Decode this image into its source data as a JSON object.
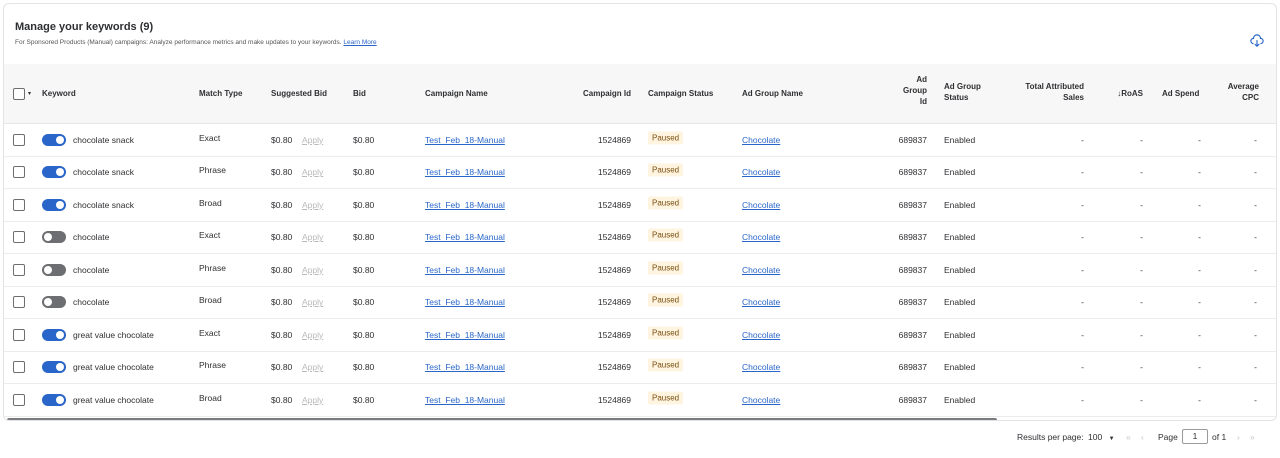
{
  "header": {
    "title": "Manage your keywords (9)",
    "subtitle": "For Sponsored Products (Manual) campaigns: Analyze performance metrics and make updates to your keywords.",
    "learn_more": "Learn More"
  },
  "columns": {
    "keyword": "Keyword",
    "match_type": "Match Type",
    "suggested_bid": "Suggested Bid",
    "bid": "Bid",
    "campaign_name": "Campaign Name",
    "campaign_id": "Campaign Id",
    "campaign_status": "Campaign Status",
    "ad_group_name": "Ad Group Name",
    "ad_group_id_1": "Ad",
    "ad_group_id_2": "Group",
    "ad_group_id_3": "Id",
    "ad_group_status_1": "Ad Group",
    "ad_group_status_2": "Status",
    "total_sales_1": "Total Attributed",
    "total_sales_2": "Sales",
    "roas": "↓RoAS",
    "ad_spend": "Ad Spend",
    "avg_cpc_1": "Average",
    "avg_cpc_2": "CPC"
  },
  "apply_label": "Apply",
  "rows": [
    {
      "enabled": true,
      "keyword": "chocolate snack",
      "match": "Exact",
      "suggested": "$0.80",
      "bid": "$0.80",
      "campaign": "Test_Feb_18-Manual",
      "campaign_id": "1524869",
      "status": "Paused",
      "ad_group": "Chocolate",
      "ad_group_id": "689837",
      "ad_group_status": "Enabled",
      "sales": "-",
      "roas": "-",
      "spend": "-",
      "cpc": "-"
    },
    {
      "enabled": true,
      "keyword": "chocolate snack",
      "match": "Phrase",
      "suggested": "$0.80",
      "bid": "$0.80",
      "campaign": "Test_Feb_18-Manual",
      "campaign_id": "1524869",
      "status": "Paused",
      "ad_group": "Chocolate",
      "ad_group_id": "689837",
      "ad_group_status": "Enabled",
      "sales": "-",
      "roas": "-",
      "spend": "-",
      "cpc": "-"
    },
    {
      "enabled": true,
      "keyword": "chocolate snack",
      "match": "Broad",
      "suggested": "$0.80",
      "bid": "$0.80",
      "campaign": "Test_Feb_18-Manual",
      "campaign_id": "1524869",
      "status": "Paused",
      "ad_group": "Chocolate",
      "ad_group_id": "689837",
      "ad_group_status": "Enabled",
      "sales": "-",
      "roas": "-",
      "spend": "-",
      "cpc": "-"
    },
    {
      "enabled": false,
      "keyword": "chocolate",
      "match": "Exact",
      "suggested": "$0.80",
      "bid": "$0.80",
      "campaign": "Test_Feb_18-Manual",
      "campaign_id": "1524869",
      "status": "Paused",
      "ad_group": "Chocolate",
      "ad_group_id": "689837",
      "ad_group_status": "Enabled",
      "sales": "-",
      "roas": "-",
      "spend": "-",
      "cpc": "-"
    },
    {
      "enabled": false,
      "keyword": "chocolate",
      "match": "Phrase",
      "suggested": "$0.80",
      "bid": "$0.80",
      "campaign": "Test_Feb_18-Manual",
      "campaign_id": "1524869",
      "status": "Paused",
      "ad_group": "Chocolate",
      "ad_group_id": "689837",
      "ad_group_status": "Enabled",
      "sales": "-",
      "roas": "-",
      "spend": "-",
      "cpc": "-"
    },
    {
      "enabled": false,
      "keyword": "chocolate",
      "match": "Broad",
      "suggested": "$0.80",
      "bid": "$0.80",
      "campaign": "Test_Feb_18-Manual",
      "campaign_id": "1524869",
      "status": "Paused",
      "ad_group": "Chocolate",
      "ad_group_id": "689837",
      "ad_group_status": "Enabled",
      "sales": "-",
      "roas": "-",
      "spend": "-",
      "cpc": "-"
    },
    {
      "enabled": true,
      "keyword": "great value chocolate",
      "match": "Exact",
      "suggested": "$0.80",
      "bid": "$0.80",
      "campaign": "Test_Feb_18-Manual",
      "campaign_id": "1524869",
      "status": "Paused",
      "ad_group": "Chocolate",
      "ad_group_id": "689837",
      "ad_group_status": "Enabled",
      "sales": "-",
      "roas": "-",
      "spend": "-",
      "cpc": "-"
    },
    {
      "enabled": true,
      "keyword": "great value chocolate",
      "match": "Phrase",
      "suggested": "$0.80",
      "bid": "$0.80",
      "campaign": "Test_Feb_18-Manual",
      "campaign_id": "1524869",
      "status": "Paused",
      "ad_group": "Chocolate",
      "ad_group_id": "689837",
      "ad_group_status": "Enabled",
      "sales": "-",
      "roas": "-",
      "spend": "-",
      "cpc": "-"
    },
    {
      "enabled": true,
      "keyword": "great value chocolate",
      "match": "Broad",
      "suggested": "$0.80",
      "bid": "$0.80",
      "campaign": "Test_Feb_18-Manual",
      "campaign_id": "1524869",
      "status": "Paused",
      "ad_group": "Chocolate",
      "ad_group_id": "689837",
      "ad_group_status": "Enabled",
      "sales": "-",
      "roas": "-",
      "spend": "-",
      "cpc": "-"
    }
  ],
  "pagination": {
    "results_label": "Results per page:",
    "per_page": "100",
    "page_label": "Page",
    "page": "1",
    "of_label": "of 1"
  },
  "colors": {
    "accent": "#2a66c9",
    "toggle_off": "#6d6e71",
    "paused_bg": "#fff4e0"
  }
}
